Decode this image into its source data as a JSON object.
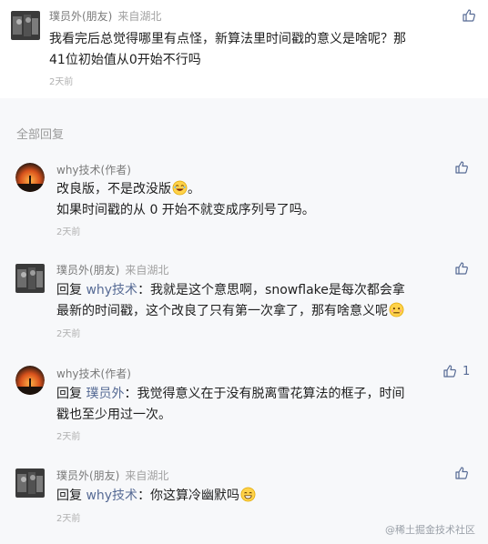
{
  "top_comment": {
    "author": "璞员外(朋友)",
    "location": "来自湖北",
    "line1": "我看完后总觉得哪里有点怪，新算法里时间戳的意义是啥呢？那",
    "line2": "41位初始值从0开始不行吗",
    "time": "2天前"
  },
  "replies_header": "全部回复",
  "replies": [
    {
      "author": "why技术(作者)",
      "location": "",
      "line1": "改良版，不是改没版",
      "line2": "如果时间戳的从 0 开始不就变成序列号了吗。",
      "time": "2天前",
      "likes": ""
    },
    {
      "author": "璞员外(朋友)",
      "location": "来自湖北",
      "reply_word": "回复",
      "reply_target": "why技术",
      "line1": "：我就是这个意思啊，snowflake是每次都会拿",
      "line2": "最新的时间戳，这个改良了只有第一次拿了，那有啥意义呢",
      "time": "2天前",
      "likes": ""
    },
    {
      "author": "why技术(作者)",
      "location": "",
      "reply_word": "回复",
      "reply_target": "璞员外",
      "line1": "：我觉得意义在于没有脱离雪花算法的框子，时间",
      "line2": "戳也至少用过一次。",
      "time": "2天前",
      "likes": "1"
    },
    {
      "author": "璞员外(朋友)",
      "location": "来自湖北",
      "reply_word": "回复",
      "reply_target": "why技术",
      "line1": "：你这算冷幽默吗",
      "time": "2天前",
      "likes": ""
    }
  ],
  "watermark": "@稀土掘金技术社区",
  "colors": {
    "link": "#576b95",
    "background_gray": "#f7f8fa"
  },
  "icons": [
    "thumbs-up-icon",
    "laugh-emoji",
    "awkward-emoji",
    "grin-emoji"
  ]
}
